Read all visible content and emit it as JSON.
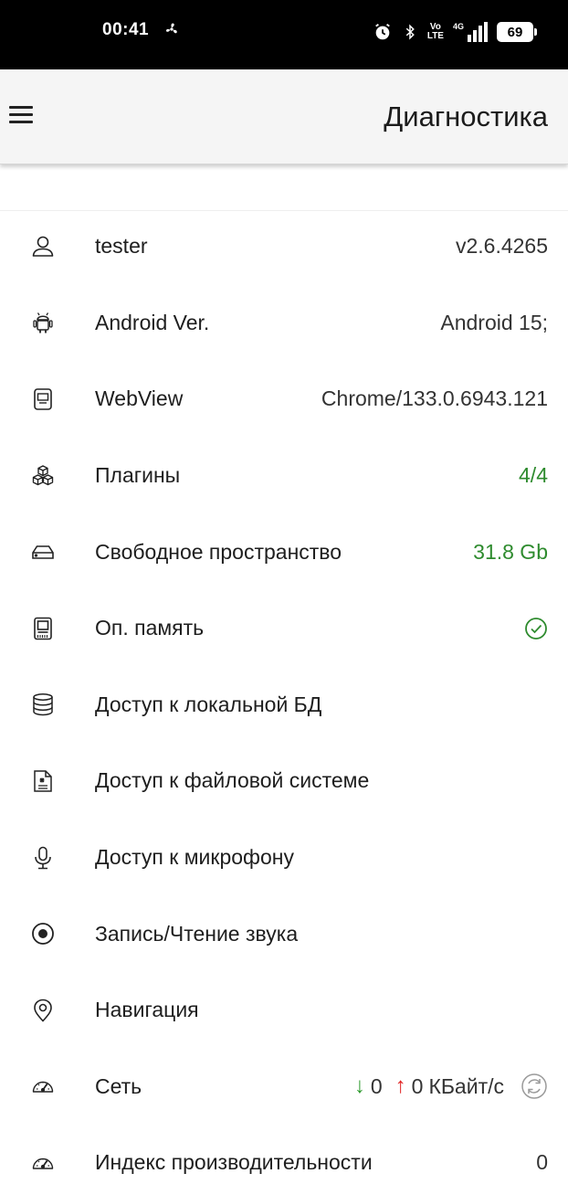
{
  "status_bar": {
    "time": "00:41",
    "volte_top": "Vo",
    "volte_bottom": "LTE",
    "network": "4G",
    "battery": "69"
  },
  "app_bar": {
    "title": "Диагностика"
  },
  "colors": {
    "accent_green": "#2e8b2e",
    "arrow_up": "#e02424",
    "arrow_down": "#2e9a2e"
  },
  "rows": [
    {
      "icon": "user-icon",
      "label": "tester",
      "value": "v2.6.4265"
    },
    {
      "icon": "android-icon",
      "label": "Android Ver.",
      "value": "Android 15;"
    },
    {
      "icon": "webview-icon",
      "label": "WebView",
      "value": "Chrome/133.0.6943.121"
    },
    {
      "icon": "cubes-icon",
      "label": "Плагины",
      "value": "4/4"
    },
    {
      "icon": "drive-icon",
      "label": "Свободное пространство",
      "value": "31.8 Gb"
    },
    {
      "icon": "memory-icon",
      "label": "Оп. память",
      "value_icon": "check-circle-icon"
    },
    {
      "icon": "database-icon",
      "label": "Доступ к локальной БД"
    },
    {
      "icon": "file-icon",
      "label": "Доступ к файловой системе"
    },
    {
      "icon": "microphone-icon",
      "label": "Доступ к микрофону"
    },
    {
      "icon": "record-icon",
      "label": "Запись/Чтение звука"
    },
    {
      "icon": "location-icon",
      "label": "Навигация"
    },
    {
      "icon": "speedometer-icon",
      "label": "Сеть",
      "download": "0",
      "upload": "0",
      "unit": "КБайт/с",
      "down_arrow": "↓",
      "up_arrow": "↑"
    },
    {
      "icon": "speedometer-icon",
      "label": "Индекс производительности",
      "value": "0"
    }
  ]
}
